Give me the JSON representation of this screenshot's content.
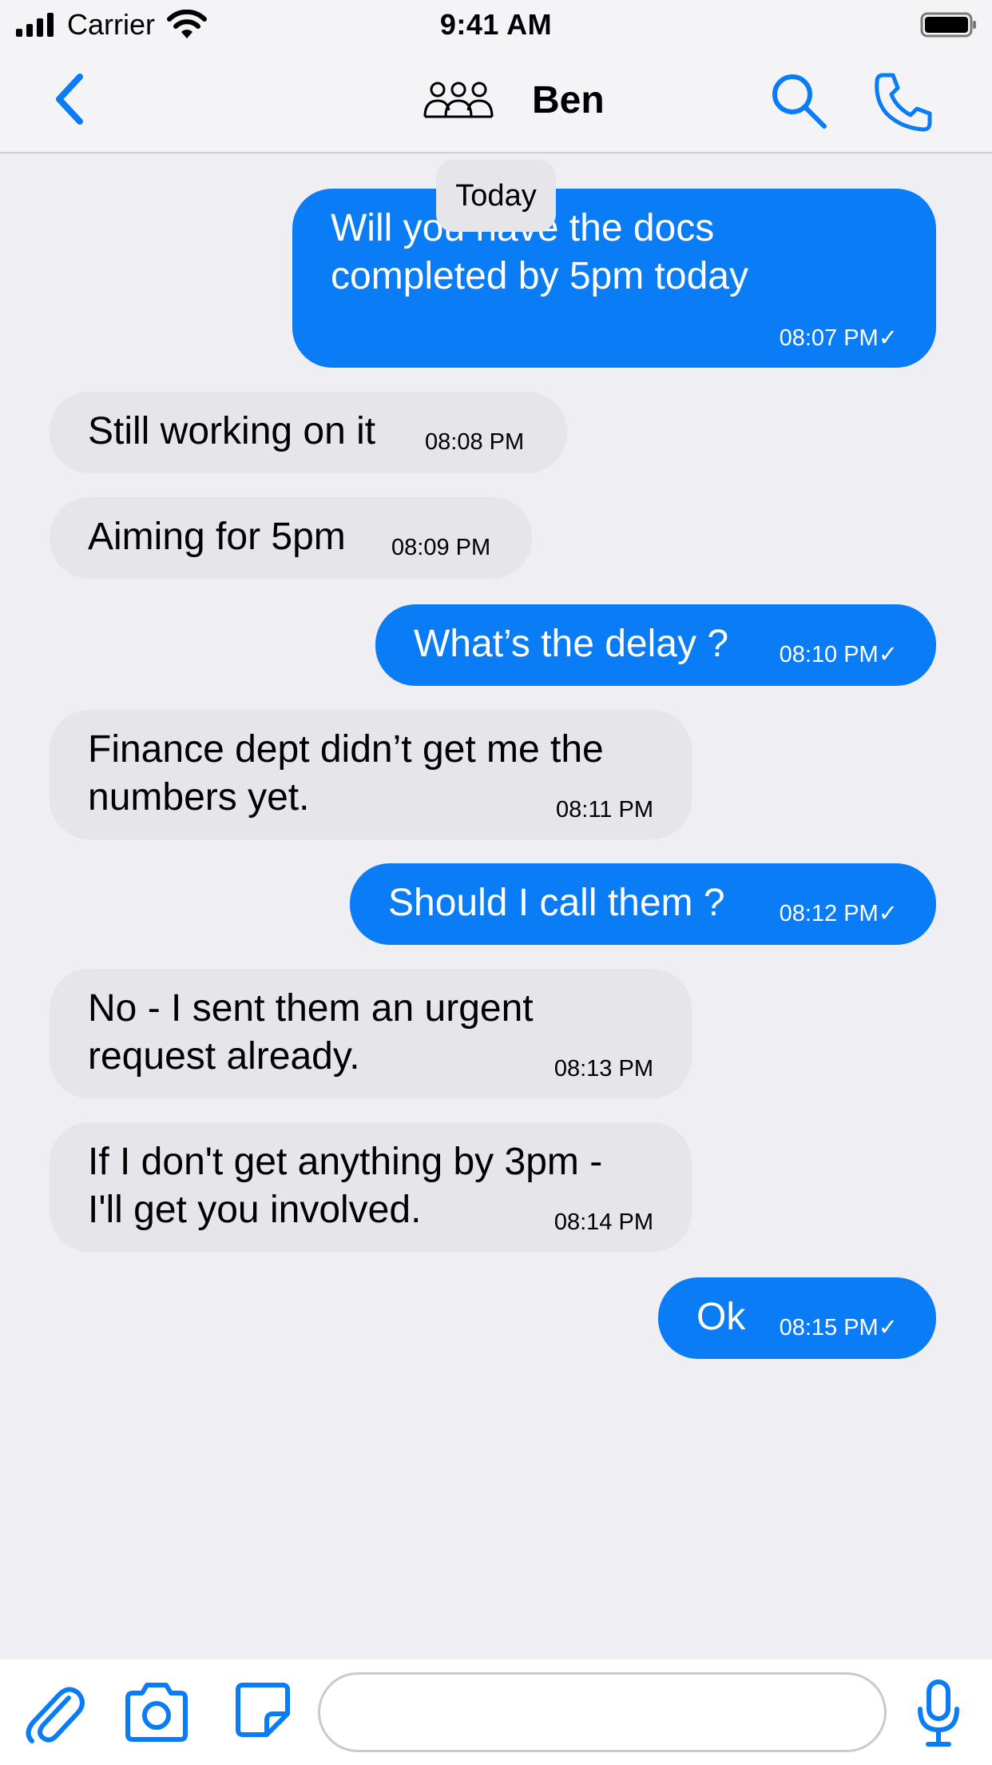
{
  "status_bar": {
    "carrier": "Carrier",
    "time": "9:41 AM",
    "icons": [
      "signal-icon",
      "wifi-icon",
      "battery-icon"
    ]
  },
  "nav": {
    "title": "Ben",
    "icons": [
      "back-chevron-icon",
      "group-icon",
      "search-icon",
      "phone-icon"
    ]
  },
  "date_label": "Today",
  "messages": [
    {
      "direction": "outgoing",
      "text": "Will you have the docs\ncompleted by 5pm today",
      "time": "08:07 PM✓"
    },
    {
      "direction": "incoming",
      "text": "Still working on it",
      "time": "08:08 PM"
    },
    {
      "direction": "incoming",
      "text": "Aiming for 5pm",
      "time": "08:09 PM"
    },
    {
      "direction": "outgoing",
      "text": "What’s the delay ?",
      "time": "08:10 PM✓"
    },
    {
      "direction": "incoming",
      "text": "Finance dept didn’t get me the\nnumbers yet.",
      "time": "08:11 PM"
    },
    {
      "direction": "outgoing",
      "text": "Should I call them ?",
      "time": "08:12 PM✓"
    },
    {
      "direction": "incoming",
      "text": "No - I sent them an urgent\nrequest already.",
      "time": "08:13 PM"
    },
    {
      "direction": "incoming",
      "text": "If I don't get anything by 3pm -\nI'll get you involved.",
      "time": "08:14 PM"
    },
    {
      "direction": "outgoing",
      "text": "Ok",
      "time": "08:15 PM✓"
    }
  ],
  "composer": {
    "placeholder": "",
    "icons": [
      "attachment-icon",
      "camera-icon",
      "sticker-icon",
      "microphone-icon"
    ]
  },
  "colors": {
    "accent": "#0a7cf6",
    "incoming_bubble": "#e5e5ea",
    "background": "#eeeef3"
  }
}
